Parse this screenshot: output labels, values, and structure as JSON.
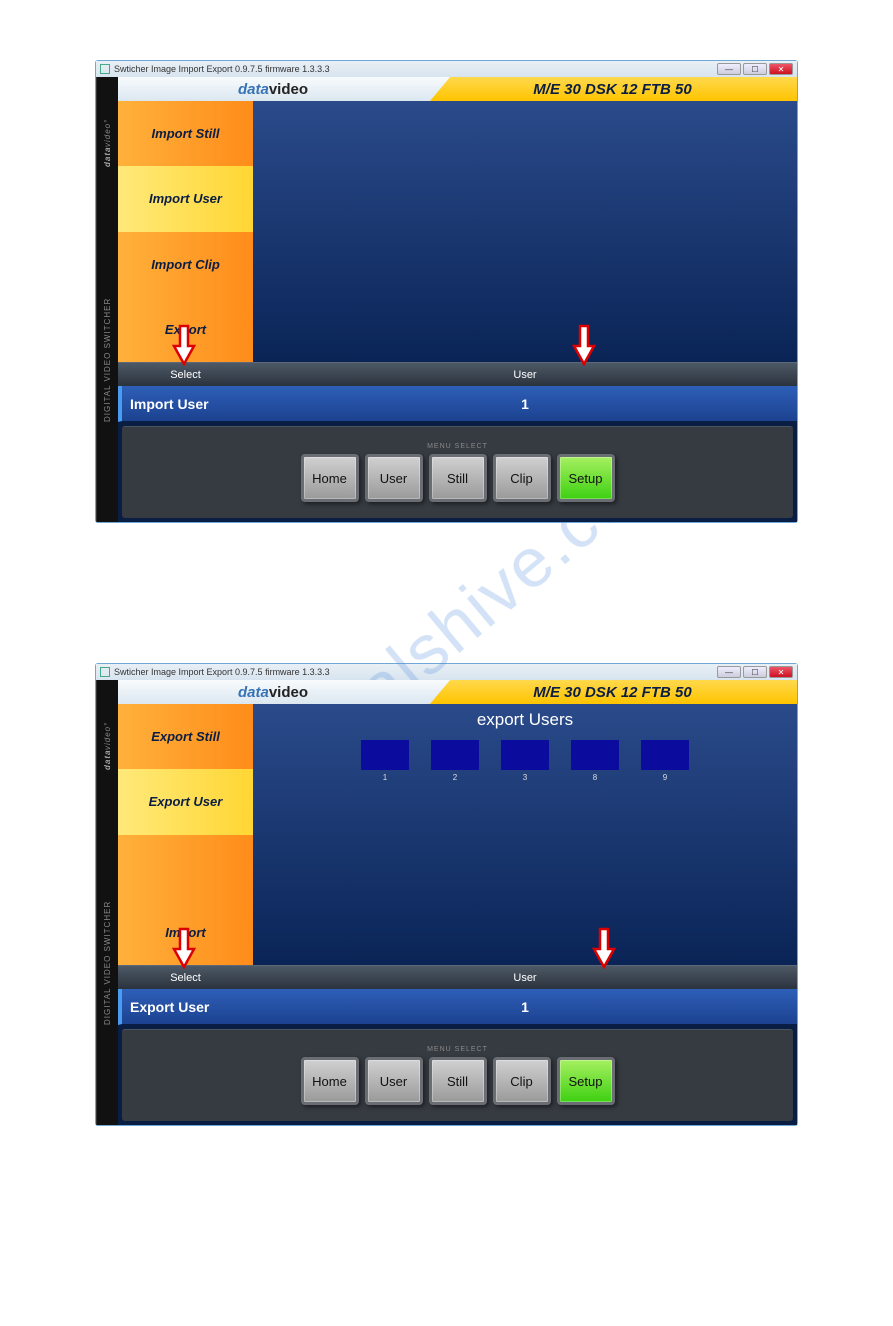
{
  "watermark": "manualshive.com",
  "window_title": "Swticher Image Import Export  0.9.7.5  firmware  1.3.3.3",
  "brand_prefix": "data",
  "brand_suffix": "video",
  "header_status": "M/E 30  DSK 12  FTB 50",
  "side_label_top": "DIGITAL VIDEO SWITCHER",
  "side_label_bot_a": "data",
  "side_label_bot_b": "video",
  "subhdr_select": "Select",
  "subhdr_user": "User",
  "menu_label": "MENU SELECT",
  "buttons": {
    "home": "Home",
    "user": "User",
    "still": "Still",
    "clip": "Clip",
    "setup": "Setup"
  },
  "shot1": {
    "tabs": [
      "Import Still",
      "Import User",
      "Import Clip",
      "Export"
    ],
    "active_tab": 1,
    "status_mode": "Import User",
    "status_value": "1"
  },
  "shot2": {
    "tabs": [
      "Export Still",
      "Export User",
      "",
      "Import"
    ],
    "active_tab": 1,
    "canvas_title": "export Users",
    "thumbs": [
      "1",
      "2",
      "3",
      "8",
      "9"
    ],
    "status_mode": "Export User",
    "status_value": "1"
  }
}
